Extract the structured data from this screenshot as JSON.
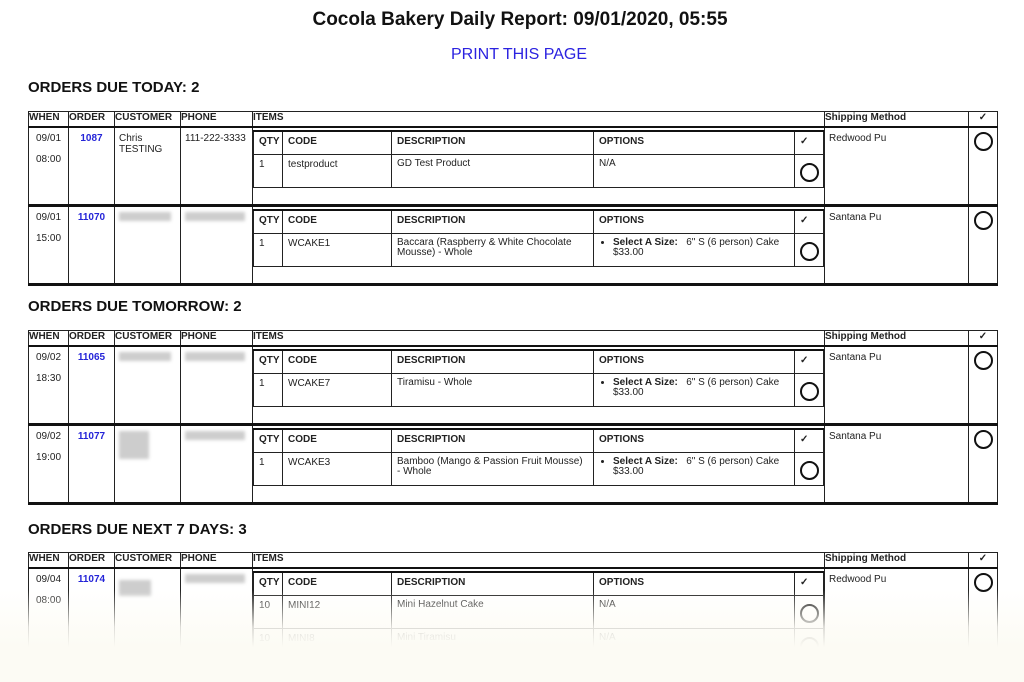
{
  "header": {
    "title": "Cocola Bakery Daily Report: 09/01/2020, 05:55",
    "print_link": "PRINT THIS PAGE"
  },
  "columns": {
    "when": "WHEN",
    "order": "ORDER",
    "customer": "CUSTOMER",
    "phone": "PHONE",
    "items": "ITEMS",
    "shipping": "Shipping Method",
    "check": "✓"
  },
  "item_columns": {
    "qty": "QTY",
    "code": "CODE",
    "description": "DESCRIPTION",
    "options": "OPTIONS",
    "check": "✓"
  },
  "sections": [
    {
      "title": "ORDERS DUE TODAY: 2",
      "orders": [
        {
          "date": "09/01",
          "time": "08:00",
          "order": "1087",
          "customer": "Chris TESTING",
          "phone": "111-222-3333",
          "customer_redacted": false,
          "shipping": "Redwood Pu",
          "items": [
            {
              "qty": "1",
              "code": "testproduct",
              "description": "GD Test Product",
              "options": "N/A"
            }
          ]
        },
        {
          "date": "09/01",
          "time": "15:00",
          "order": "11070",
          "customer": "",
          "phone": "",
          "customer_redacted": true,
          "shipping": "Santana Pu",
          "items": [
            {
              "qty": "1",
              "code": "WCAKE1",
              "description": "Baccara (Raspberry & White Chocolate Mousse) - Whole",
              "option_label": "Select A Size:",
              "option_value": "6\" S (6 person) Cake",
              "option_price": "$33.00"
            }
          ]
        }
      ]
    },
    {
      "title": "ORDERS DUE TOMORROW: 2",
      "orders": [
        {
          "date": "09/02",
          "time": "18:30",
          "order": "11065",
          "customer": "",
          "phone": "",
          "customer_redacted": true,
          "shipping": "Santana Pu",
          "items": [
            {
              "qty": "1",
              "code": "WCAKE7",
              "description": "Tiramisu - Whole",
              "option_label": "Select A Size:",
              "option_value": "6\" S (6 person) Cake",
              "option_price": "$33.00"
            }
          ]
        },
        {
          "date": "09/02",
          "time": "19:00",
          "order": "11077",
          "customer": "",
          "phone": "",
          "customer_redacted": true,
          "shipping": "Santana Pu",
          "items": [
            {
              "qty": "1",
              "code": "WCAKE3",
              "description": "Bamboo (Mango & Passion Fruit Mousse) - Whole",
              "option_label": "Select A Size:",
              "option_value": "6\" S (6 person) Cake",
              "option_price": "$33.00"
            }
          ]
        }
      ]
    },
    {
      "title": "ORDERS DUE NEXT 7 DAYS: 3",
      "orders": [
        {
          "date": "09/04",
          "time": "08:00",
          "order": "11074",
          "customer": "",
          "phone": "",
          "customer_redacted": true,
          "shipping": "Redwood Pu",
          "items": [
            {
              "qty": "10",
              "code": "MINI12",
              "description": "Mini Hazelnut Cake",
              "options": "N/A"
            },
            {
              "qty": "10",
              "code": "MINI8",
              "description": "Mini Tiramisu",
              "options": "N/A"
            }
          ]
        }
      ]
    }
  ]
}
